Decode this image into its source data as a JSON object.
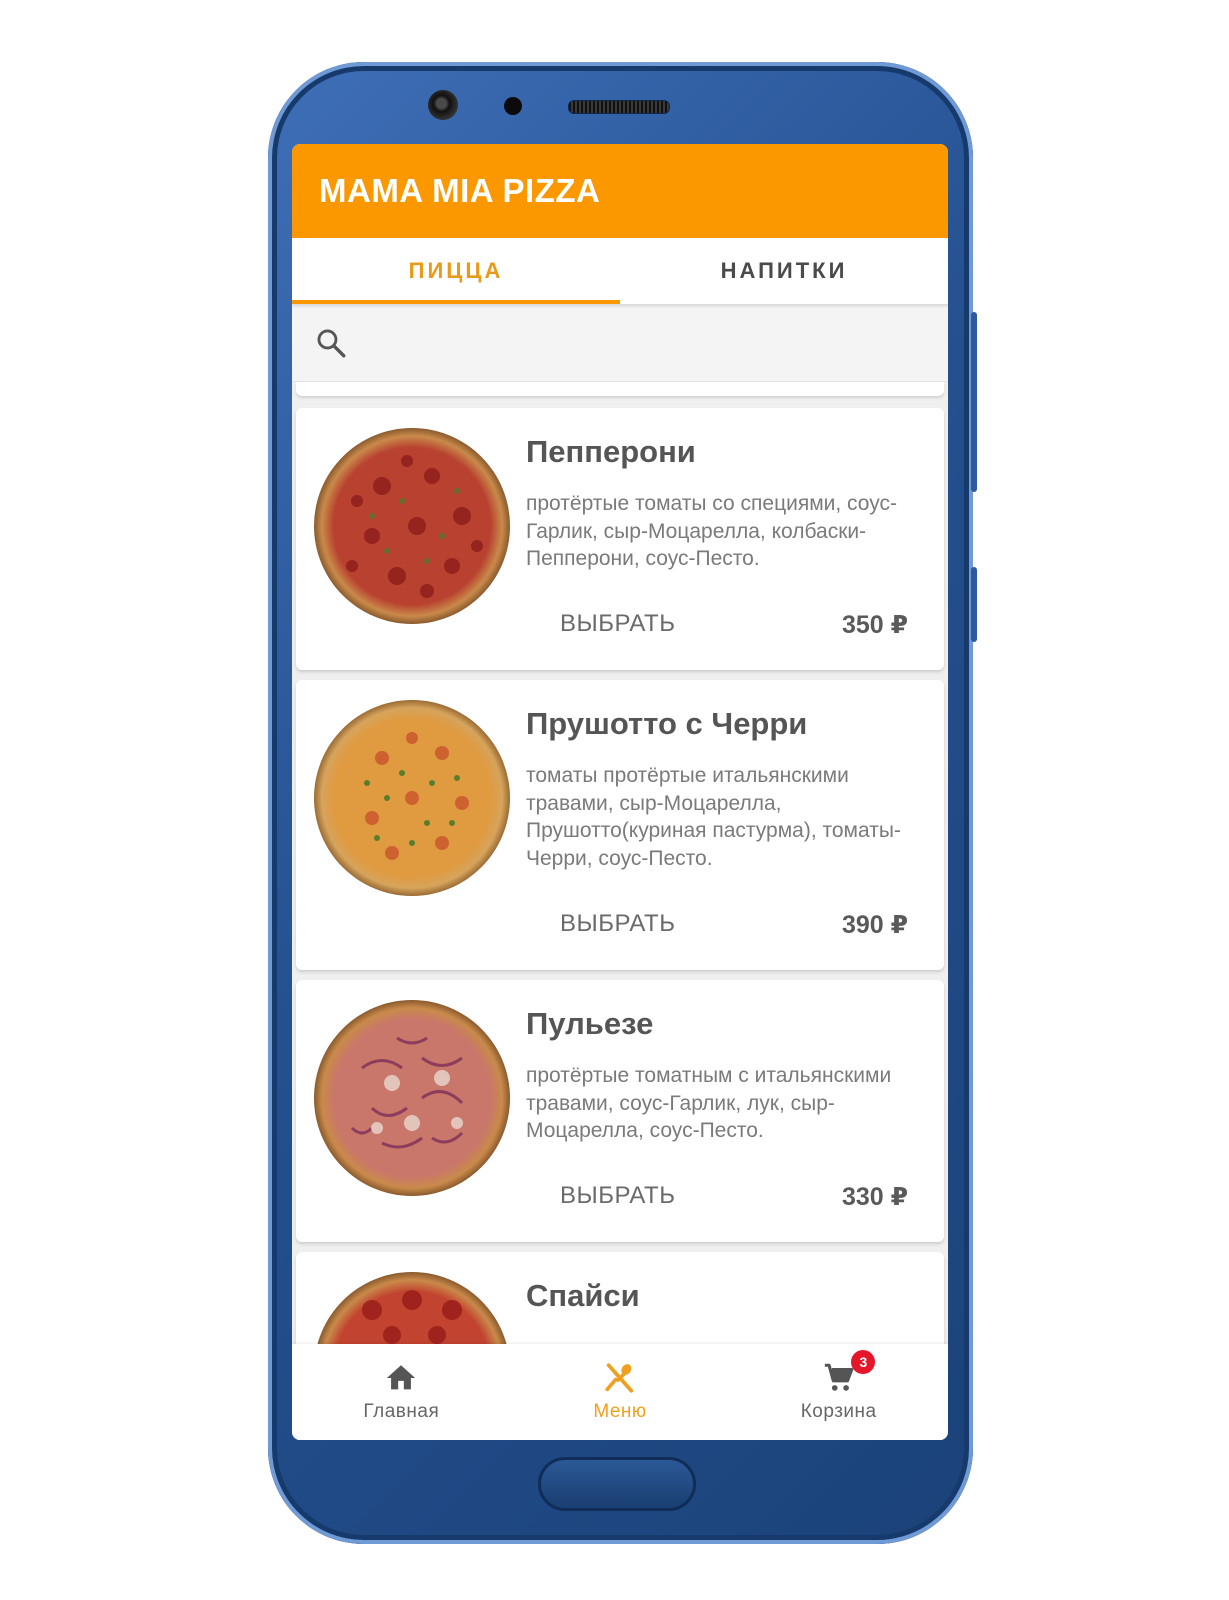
{
  "app": {
    "title": "MAMA MIA PIZZA",
    "accent_color": "#fb9800"
  },
  "tabs": [
    {
      "label": "ПИЦЦА",
      "active": true
    },
    {
      "label": "НАПИТКИ",
      "active": false
    }
  ],
  "search": {
    "icon": "search-icon",
    "placeholder": "",
    "value": ""
  },
  "products": [
    {
      "name": "Пепперони",
      "description": "протёртые томаты со специями, соус-Гарлик, сыр-Моцарелла, колбаски-Пепперони, соус-Песто.",
      "action_label": "ВЫБРАТЬ",
      "price": "350 ₽"
    },
    {
      "name": "Прушотто с Черри",
      "description": "томаты протёртые итальянскими травами, сыр-Моцарелла, Прушотто(куриная пастурма), томаты-Черри, соус-Песто.",
      "action_label": "ВЫБРАТЬ",
      "price": "390 ₽"
    },
    {
      "name": "Пульезе",
      "description": "протёртые томатным с итальянскими травами, соус-Гарлик, лук, сыр-Моцарелла, соус-Песто.",
      "action_label": "ВЫБРАТЬ",
      "price": "330 ₽"
    },
    {
      "name": "Спайси",
      "description": "",
      "action_label": "",
      "price": ""
    }
  ],
  "bottom_nav": [
    {
      "label": "Главная",
      "icon": "home-icon",
      "active": false
    },
    {
      "label": "Меню",
      "icon": "menu-utensils-icon",
      "active": true
    },
    {
      "label": "Корзина",
      "icon": "cart-icon",
      "active": false,
      "badge": "3"
    }
  ]
}
